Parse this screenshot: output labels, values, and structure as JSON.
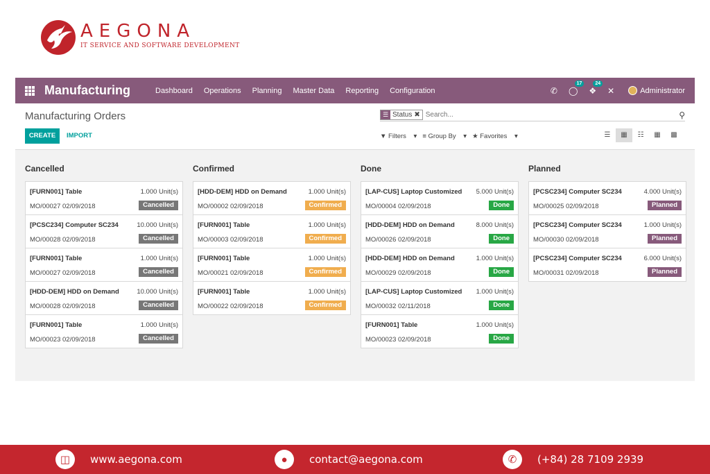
{
  "brand": {
    "name": "AEGONA",
    "tagline": "IT SERVICE AND SOFTWARE DEVELOPMENT",
    "color": "#c0242b"
  },
  "topbar": {
    "app_title": "Manufacturing",
    "menu": [
      "Dashboard",
      "Operations",
      "Planning",
      "Master Data",
      "Reporting",
      "Configuration"
    ],
    "chat_count": "17",
    "activity_count": "24",
    "user": "Administrator",
    "color": "#875a7b"
  },
  "control": {
    "breadcrumb": "Manufacturing Orders",
    "create_label": "CREATE",
    "import_label": "IMPORT",
    "facet_label": "Status",
    "search_placeholder": "Search...",
    "filters_label": "Filters",
    "groupby_label": "Group By",
    "favorites_label": "Favorites"
  },
  "columns": [
    {
      "title": "Cancelled",
      "cards": [
        {
          "name": "[FURN001] Table",
          "qty": "1.000 Unit(s)",
          "ref": "MO/00027 02/09/2018",
          "status": "Cancelled",
          "cls": "st-cancelled"
        },
        {
          "name": "[PCSC234] Computer SC234",
          "qty": "10.000 Unit(s)",
          "ref": "MO/00028 02/09/2018",
          "status": "Cancelled",
          "cls": "st-cancelled"
        },
        {
          "name": "[FURN001] Table",
          "qty": "1.000 Unit(s)",
          "ref": "MO/00027 02/09/2018",
          "status": "Cancelled",
          "cls": "st-cancelled"
        },
        {
          "name": "[HDD-DEM] HDD on Demand",
          "qty": "10.000 Unit(s)",
          "ref": "MO/00028 02/09/2018",
          "status": "Cancelled",
          "cls": "st-cancelled"
        },
        {
          "name": "[FURN001] Table",
          "qty": "1.000 Unit(s)",
          "ref": "MO/00023 02/09/2018",
          "status": "Cancelled",
          "cls": "st-cancelled"
        }
      ]
    },
    {
      "title": "Confirmed",
      "cards": [
        {
          "name": "[HDD-DEM] HDD on Demand",
          "qty": "1.000 Unit(s)",
          "ref": "MO/00002 02/09/2018",
          "status": "Confirmed",
          "cls": "st-confirmed"
        },
        {
          "name": "[FURN001] Table",
          "qty": "1.000 Unit(s)",
          "ref": "MO/00003 02/09/2018",
          "status": "Confirmed",
          "cls": "st-confirmed"
        },
        {
          "name": "[FURN001] Table",
          "qty": "1.000 Unit(s)",
          "ref": "MO/00021 02/09/2018",
          "status": "Confirmed",
          "cls": "st-confirmed"
        },
        {
          "name": "[FURN001] Table",
          "qty": "1.000 Unit(s)",
          "ref": "MO/00022 02/09/2018",
          "status": "Confirmed",
          "cls": "st-confirmed"
        }
      ]
    },
    {
      "title": "Done",
      "cards": [
        {
          "name": "[LAP-CUS] Laptop Customized",
          "qty": "5.000 Unit(s)",
          "ref": "MO/00004 02/09/2018",
          "status": "Done",
          "cls": "st-done"
        },
        {
          "name": "[HDD-DEM] HDD on Demand",
          "qty": "8.000 Unit(s)",
          "ref": "MO/00026 02/09/2018",
          "status": "Done",
          "cls": "st-done"
        },
        {
          "name": "[HDD-DEM] HDD on Demand",
          "qty": "1.000 Unit(s)",
          "ref": "MO/00029 02/09/2018",
          "status": "Done",
          "cls": "st-done"
        },
        {
          "name": "[LAP-CUS] Laptop Customized",
          "qty": "1.000 Unit(s)",
          "ref": "MO/00032 02/11/2018",
          "status": "Done",
          "cls": "st-done"
        },
        {
          "name": "[FURN001] Table",
          "qty": "1.000 Unit(s)",
          "ref": "MO/00023 02/09/2018",
          "status": "Done",
          "cls": "st-done"
        }
      ]
    },
    {
      "title": "Planned",
      "cards": [
        {
          "name": "[PCSC234] Computer SC234",
          "qty": "4.000 Unit(s)",
          "ref": "MO/00025 02/09/2018",
          "status": "Planned",
          "cls": "st-planned"
        },
        {
          "name": "[PCSC234] Computer SC234",
          "qty": "1.000 Unit(s)",
          "ref": "MO/00030 02/09/2018",
          "status": "Planned",
          "cls": "st-planned"
        },
        {
          "name": "[PCSC234] Computer SC234",
          "qty": "6.000 Unit(s)",
          "ref": "MO/00031 02/09/2018",
          "status": "Planned",
          "cls": "st-planned"
        }
      ]
    }
  ],
  "footer": {
    "website": "www.aegona.com",
    "email": "contact@aegona.com",
    "phone": "(+84) 28 7109 2939",
    "color": "#c4262e"
  }
}
